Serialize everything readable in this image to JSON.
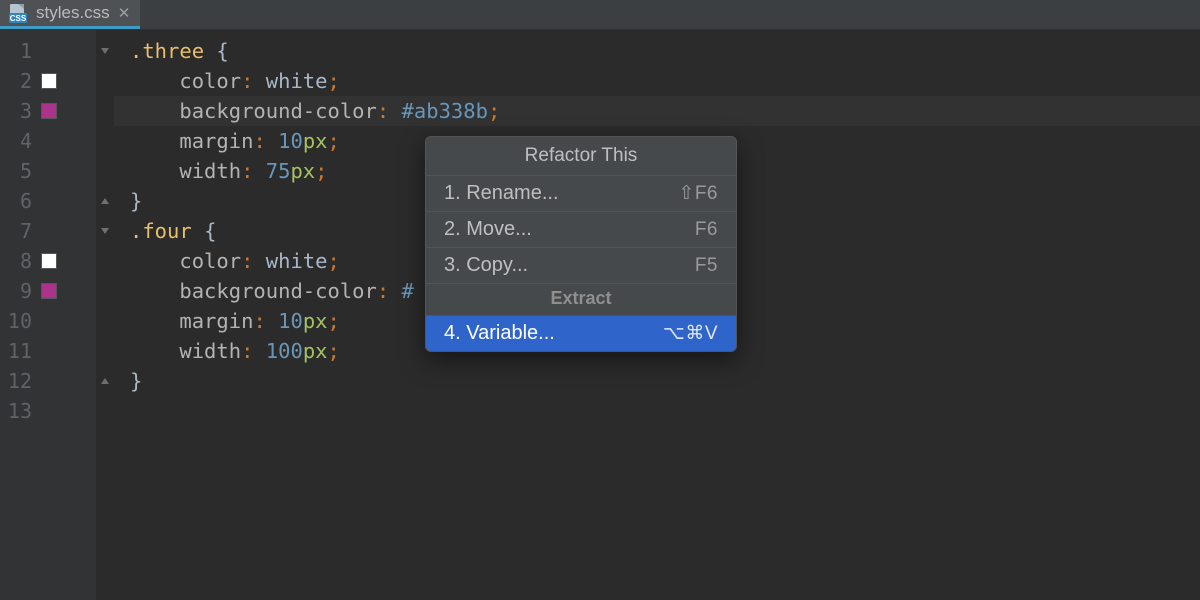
{
  "tab": {
    "filename": "styles.css",
    "icon": "css-file-icon"
  },
  "gutter": {
    "swatches": {
      "2": "#FFFFFF",
      "3": "#AB338B",
      "8": "#FFFFFF",
      "9": "#AB338B"
    },
    "fold": {
      "1": "open",
      "6": "close",
      "7": "open",
      "12": "close"
    }
  },
  "lines": [
    {
      "n": 1,
      "html": "<span class='selector'>.three</span> <span class='brace'>{</span>"
    },
    {
      "n": 2,
      "html": "    <span class='prop'>color</span><span class='punct'>:</span> <span class='val'>white</span><span class='punct'>;</span>"
    },
    {
      "n": 3,
      "hl": true,
      "html": "    <span class='prop'>background-color</span><span class='punct'>:</span> <span class='hex'>#ab338b</span><span class='punct'>;</span>"
    },
    {
      "n": 4,
      "html": "    <span class='prop'>margin</span><span class='punct'>:</span> <span class='num'>10</span><span class='unit'>px</span><span class='punct'>;</span>"
    },
    {
      "n": 5,
      "html": "    <span class='prop'>width</span><span class='punct'>:</span> <span class='num'>75</span><span class='unit'>px</span><span class='punct'>;</span>"
    },
    {
      "n": 6,
      "html": "<span class='brace'>}</span>"
    },
    {
      "n": 7,
      "html": "<span class='selector'>.four</span> <span class='brace'>{</span>"
    },
    {
      "n": 8,
      "html": "    <span class='prop'>color</span><span class='punct'>:</span> <span class='val'>white</span><span class='punct'>;</span>"
    },
    {
      "n": 9,
      "html": "    <span class='prop'>background-color</span><span class='punct'>:</span> <span class='hex'>#</span>"
    },
    {
      "n": 10,
      "html": "    <span class='prop'>margin</span><span class='punct'>:</span> <span class='num'>10</span><span class='unit'>px</span><span class='punct'>;</span>"
    },
    {
      "n": 11,
      "html": "    <span class='prop'>width</span><span class='punct'>:</span> <span class='num'>100</span><span class='unit'>px</span><span class='punct'>;</span>"
    },
    {
      "n": 12,
      "html": "<span class='brace'>}</span>"
    },
    {
      "n": 13,
      "html": ""
    }
  ],
  "popup": {
    "title": "Refactor This",
    "items": [
      {
        "label": "1. Rename...",
        "shortcut": "⇧F6"
      },
      {
        "label": "2. Move...",
        "shortcut": "F6"
      },
      {
        "label": "3. Copy...",
        "shortcut": "F5"
      }
    ],
    "section": "Extract",
    "extract_items": [
      {
        "label": "4. Variable...",
        "shortcut": "⌥⌘V",
        "selected": true
      }
    ]
  }
}
